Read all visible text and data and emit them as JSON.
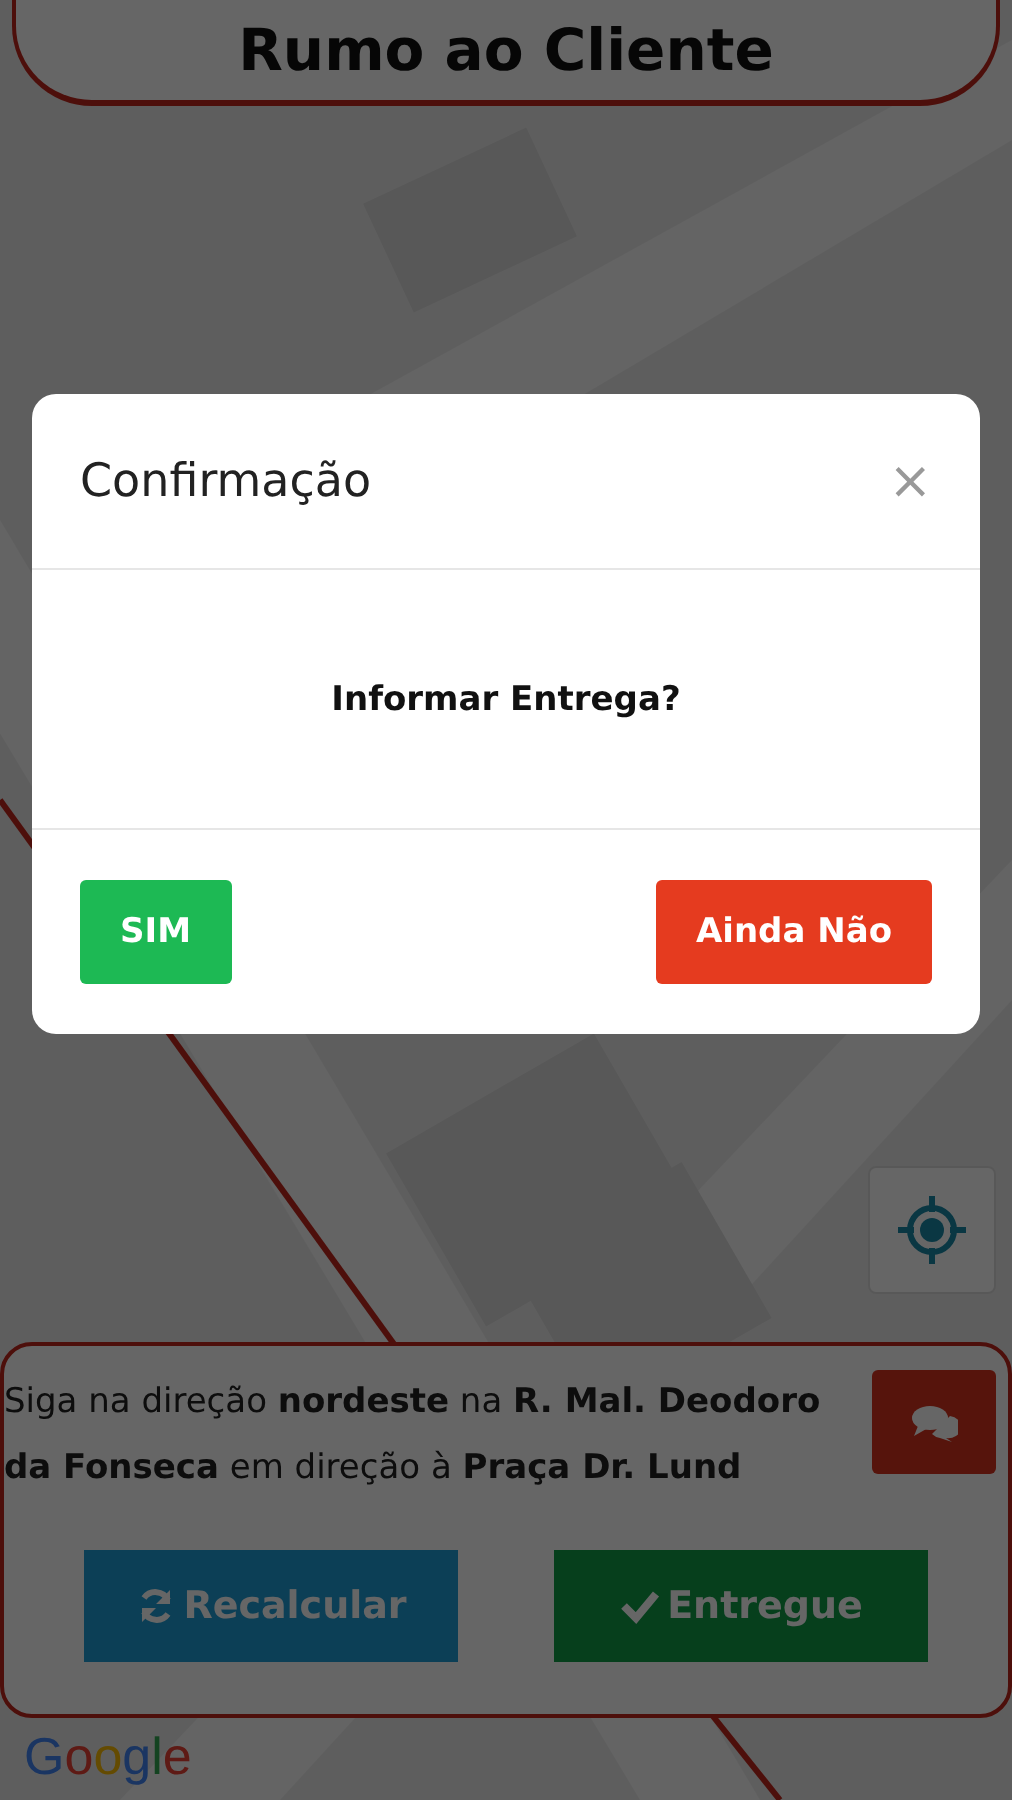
{
  "header": {
    "title": "Rumo ao Cliente"
  },
  "locate_button": {
    "kind": "locate"
  },
  "directions": {
    "text": "Siga na direção **nordeste** na **R. Mal. Deodoro da Fonseca** em direção à **Praça Dr. Lund**",
    "buttons": [
      {
        "label": "Recalcular",
        "kind": "recalc"
      },
      {
        "label": "Entregue",
        "kind": "done"
      }
    ]
  },
  "map_logo": "Google",
  "dialog": {
    "title": "Confirmação",
    "close": "×",
    "message": "Informar Entrega?",
    "buttons": [
      {
        "label": "SIM",
        "kind": "confirm"
      },
      {
        "label": "Ainda Não",
        "kind": "cancel"
      }
    ]
  }
}
